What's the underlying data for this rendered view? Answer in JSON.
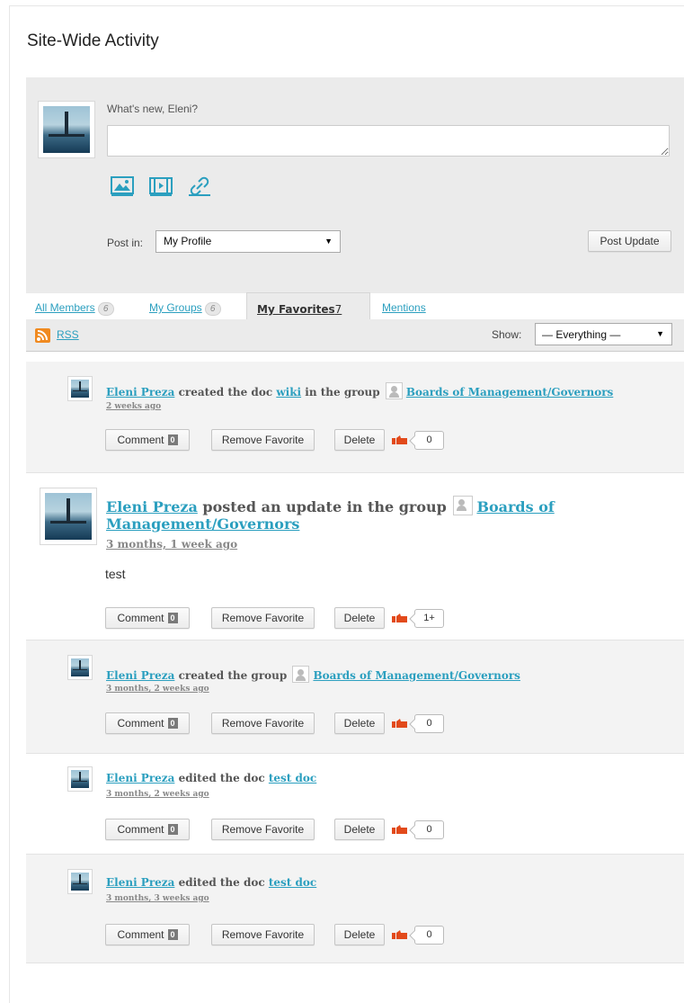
{
  "page_title": "Site-Wide Activity",
  "whats_new": {
    "label": "What's new, Eleni?",
    "textarea_value": "",
    "media_icons": [
      "image-icon",
      "video-icon",
      "link-icon"
    ],
    "post_in_label": "Post in:",
    "post_in_selected": "My Profile",
    "post_button": "Post Update"
  },
  "tabs": [
    {
      "label": "All Members",
      "count": "6"
    },
    {
      "label": "My Groups",
      "count": "6"
    },
    {
      "label": "My Favorites",
      "count": "7",
      "active": true
    },
    {
      "label": "Mentions"
    }
  ],
  "subnav": {
    "rss_label": "RSS",
    "show_label": "Show:",
    "show_selected": "— Everything —"
  },
  "buttons": {
    "comment": "Comment",
    "remove_favorite": "Remove Favorite",
    "delete": "Delete"
  },
  "activities": [
    {
      "user": "Eleni Preza",
      "action": "created the doc",
      "object": "wiki",
      "connector": "in the group",
      "group": "Boards of Management/Governors",
      "time": "2 weeks ago",
      "comments": "0",
      "likes": "0"
    },
    {
      "user": "Eleni Preza",
      "action": "posted an update in the group",
      "group": "Boards of",
      "group_line2": "Management/Governors",
      "time": "3 months, 1 week ago",
      "body": "test",
      "comments": "0",
      "likes": "1+"
    },
    {
      "user": "Eleni Preza",
      "action": "created the group",
      "group": "Boards of Management/Governors",
      "time": "3 months, 2 weeks ago",
      "comments": "0",
      "likes": "0"
    },
    {
      "user": "Eleni Preza",
      "action": "edited the doc",
      "object": "test doc",
      "time": "3 months, 2 weeks ago",
      "comments": "0",
      "likes": "0"
    },
    {
      "user": "Eleni Preza",
      "action": "edited the doc",
      "object": "test doc",
      "time": "3 months, 3 weeks ago",
      "comments": "0",
      "likes": "0"
    }
  ]
}
